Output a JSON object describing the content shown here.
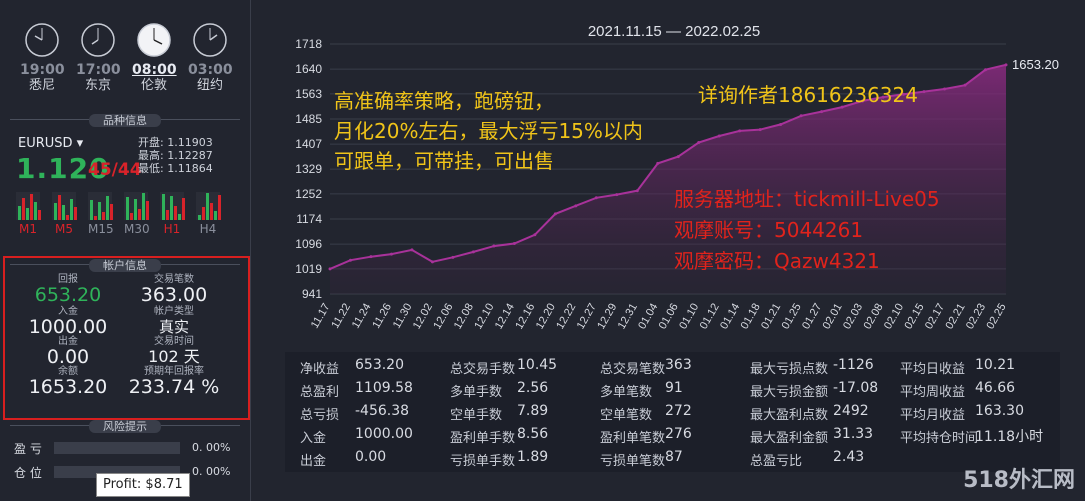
{
  "clocks": [
    {
      "time": "19:00",
      "city": "悉尼",
      "active": false
    },
    {
      "time": "17:00",
      "city": "东京",
      "active": false
    },
    {
      "time": "08:00",
      "city": "伦敦",
      "active": true
    },
    {
      "time": "03:00",
      "city": "纽约",
      "active": false
    }
  ],
  "product": {
    "section_title": "品种信息",
    "symbol": "EURUSD",
    "price_main": "1.120",
    "price_overlap": "45/44",
    "open": "开盘: 1.11903",
    "high": "最高: 1.12287",
    "low": "最低: 1.11864",
    "timeframes": [
      "M1",
      "M5",
      "M15",
      "M30",
      "H1",
      "H4"
    ],
    "timeframe_colors": [
      "#d8232a",
      "#d8232a",
      "#8a8f9c",
      "#8a8f9c",
      "#d8232a",
      "#8a8f9c"
    ]
  },
  "account": {
    "section_title": "帐户信息",
    "return_label": "回报",
    "return_value": "653.20",
    "trades_label": "交易笔数",
    "trades_value": "363.00",
    "deposit_label": "入金",
    "deposit_value": "1000.00",
    "type_label": "帐户类型",
    "type_value": "真实",
    "withdraw_label": "出金",
    "withdraw_value": "0.00",
    "time_label": "交易时间",
    "time_value": "102 天",
    "balance_label": "余额",
    "balance_value": "1653.20",
    "annual_label": "预期年回报率",
    "annual_value": "233.74 %"
  },
  "risk": {
    "section_title": "风险提示",
    "profit_label": "盈 亏",
    "profit_value": "0. 00%",
    "position_label": "仓 位",
    "position_value": "0. 00%"
  },
  "tooltip": "Profit: $8.71",
  "chart_data": {
    "type": "area",
    "title": "2021.11.15 — 2022.02.25",
    "x": [
      "11.17",
      "11.22",
      "11.24",
      "11.26",
      "11.30",
      "12.02",
      "12.06",
      "12.08",
      "12.10",
      "12.14",
      "12.16",
      "12.20",
      "12.22",
      "12.27",
      "12.29",
      "12.31",
      "01.04",
      "01.06",
      "01.10",
      "01.12",
      "01.14",
      "01.18",
      "01.21",
      "01.25",
      "01.27",
      "02.01",
      "02.03",
      "02.08",
      "02.10",
      "02.15",
      "02.17",
      "02.21",
      "02.23",
      "02.25"
    ],
    "y": [
      1019,
      1046,
      1057,
      1065,
      1078,
      1041,
      1055,
      1072,
      1090,
      1098,
      1125,
      1190,
      1215,
      1240,
      1250,
      1262,
      1347,
      1368,
      1412,
      1432,
      1448,
      1452,
      1468,
      1495,
      1508,
      1522,
      1541,
      1553,
      1562,
      1570,
      1578,
      1590,
      1638,
      1653.2
    ],
    "yticks": [
      941,
      1019,
      1096,
      1174,
      1252,
      1329,
      1407,
      1485,
      1563,
      1640,
      1718
    ],
    "ylim": [
      941,
      1718
    ],
    "last_label": "1653.20",
    "color": "#a8329a"
  },
  "overlay": {
    "left_lines": [
      "高准确率策略，跑磅钮，",
      "月化20%左右，最大浮亏15%以内",
      "可跟单，可带挂，可出售"
    ],
    "contact": "详询作者18616236324",
    "server_lines": [
      "服务器地址：tickmill-Live05",
      "观摩账号：5044261",
      "观摩密码：Qazw4321"
    ]
  },
  "stats": {
    "col1": [
      [
        "净收益",
        "653.20"
      ],
      [
        "总盈利",
        "1109.58"
      ],
      [
        "总亏损",
        "-456.38"
      ],
      [
        "入金",
        "1000.00"
      ],
      [
        "出金",
        "0.00"
      ]
    ],
    "col2": [
      [
        "总交易手数",
        "10.45"
      ],
      [
        "多单手数",
        "2.56"
      ],
      [
        "空单手数",
        "7.89"
      ],
      [
        "盈利单手数",
        "8.56"
      ],
      [
        "亏损单手数",
        "1.89"
      ]
    ],
    "col3": [
      [
        "总交易笔数",
        "363"
      ],
      [
        "多单笔数",
        "91"
      ],
      [
        "空单笔数",
        "272"
      ],
      [
        "盈利单笔数",
        "276"
      ],
      [
        "亏损单笔数",
        "87"
      ]
    ],
    "col4": [
      [
        "最大亏损点数",
        "-1126"
      ],
      [
        "最大亏损金额",
        "-17.08"
      ],
      [
        "最大盈利点数",
        "2492"
      ],
      [
        "最大盈利金额",
        "31.33"
      ],
      [
        "总盈亏比",
        "2.43"
      ]
    ],
    "col5": [
      [
        "平均日收益",
        "10.21"
      ],
      [
        "平均周收益",
        "46.66"
      ],
      [
        "平均月收益",
        "163.30"
      ],
      [
        "平均持仓时间",
        "11.18小时"
      ]
    ]
  },
  "watermark": "518外汇网"
}
